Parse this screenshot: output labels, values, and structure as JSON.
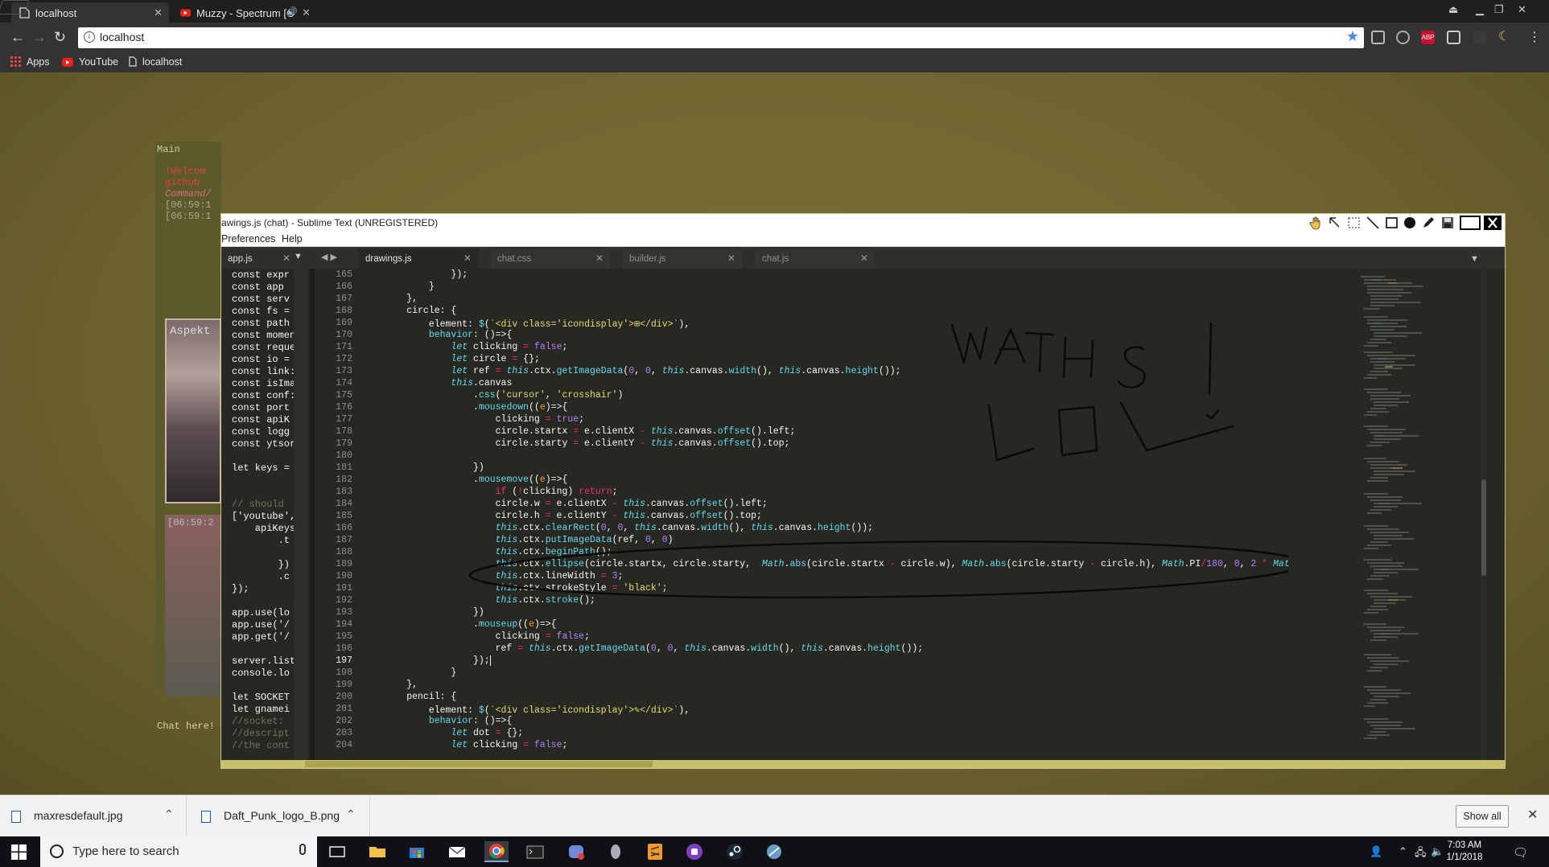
{
  "browser": {
    "tabs": [
      {
        "title": "localhost",
        "active": true
      },
      {
        "title": "Muzzy - Spectrum [O",
        "active": false
      }
    ],
    "url": "localhost",
    "bookmarks": [
      {
        "label": "Apps",
        "icon": "apps-grid-icon"
      },
      {
        "label": "YouTube",
        "icon": "youtube-icon"
      },
      {
        "label": "localhost",
        "icon": "page-icon"
      }
    ]
  },
  "chat": {
    "main_label": "Main",
    "lines": [
      "!Welcom",
      "github",
      "Command/",
      "[06:59:1",
      "[06:59:1"
    ],
    "image_text": "Aspekt",
    "image2_text": "[06:59:2",
    "prompt": "Chat here!"
  },
  "sublime": {
    "title": "awings.js (chat) - Sublime Text (UNREGISTERED)",
    "menus": [
      "Preferences",
      "Help"
    ],
    "left_tab": "app.js",
    "tabs": [
      {
        "label": "drawings.js",
        "active": true
      },
      {
        "label": "chat.css",
        "active": false
      },
      {
        "label": "builder.js",
        "active": false
      },
      {
        "label": "chat.js",
        "active": false
      }
    ],
    "left_lines": [
      "const expr",
      "const app ",
      "const serv",
      "const fs =",
      "const path",
      "const momen",
      "const reque",
      "const io =",
      "const link:",
      "const isIma",
      "const conf:",
      "const port ",
      "const apiK",
      "const logg",
      "const ytsor",
      "",
      "let keys =",
      "",
      "",
      "// should ",
      "['youtube',",
      "    apiKeys",
      "        .t",
      "",
      "        })",
      "        .c",
      "});",
      "",
      "app.use(lo",
      "app.use('/",
      "app.get('/",
      "",
      "server.list",
      "console.lo",
      "",
      "let SOCKET ",
      "let gnamei",
      "//socket: ",
      "//descript",
      "//the cont"
    ],
    "line_numbers": [
      165,
      166,
      167,
      168,
      169,
      170,
      171,
      172,
      173,
      174,
      175,
      176,
      177,
      178,
      179,
      180,
      181,
      182,
      183,
      184,
      185,
      186,
      187,
      188,
      189,
      190,
      191,
      192,
      193,
      194,
      195,
      196,
      197,
      198,
      199,
      200,
      201,
      202,
      203,
      204
    ],
    "current_line": 197,
    "drawing_text": "MATHS ! LOL"
  },
  "downloads": [
    {
      "name": "maxresdefault.jpg"
    },
    {
      "name": "Daft_Punk_logo_B.png"
    }
  ],
  "shelf": {
    "show_all": "Show all"
  },
  "taskbar": {
    "search_placeholder": "Type here to search",
    "time": "7:03 AM",
    "date": "1/1/2018"
  },
  "colors": {
    "page_bg": "#6f6430",
    "editor_bg": "#272822",
    "keyword": "#66d9ef",
    "string": "#e6db74",
    "operator": "#f92672",
    "number": "#ae81ff"
  }
}
